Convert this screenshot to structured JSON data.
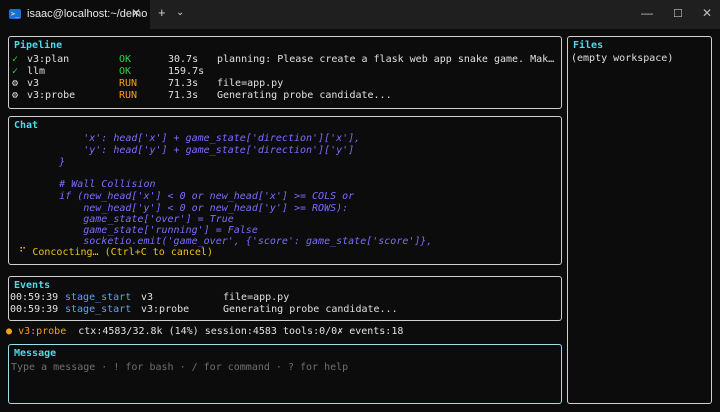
{
  "window": {
    "tab_title": "isaac@localhost:~/demo",
    "tab_icon": "terminal-icon",
    "close_glyph": "✕",
    "new_tab_glyph": "+",
    "dropdown_glyph": "⌄",
    "minimize_glyph": "—",
    "maximize_glyph": "☐",
    "closewin_glyph": "✕"
  },
  "pipeline": {
    "title": "Pipeline",
    "rows": [
      {
        "icon": "✓",
        "name": "v3:plan",
        "status": "OK",
        "time": "30.7s",
        "detail": "planning: Please create a flask web app snake game. Make no …"
      },
      {
        "icon": "✓",
        "name": "llm",
        "status": "OK",
        "time": "159.7s",
        "detail": ""
      },
      {
        "icon": "⚙",
        "name": "v3",
        "status": "RUN",
        "time": "71.3s",
        "detail": "file=app.py"
      },
      {
        "icon": "⚙",
        "name": "v3:probe",
        "status": "RUN",
        "time": "71.3s",
        "detail": "Generating probe candidate..."
      }
    ]
  },
  "chat": {
    "title": "Chat",
    "lines": [
      "            'x': head['x'] + game_state['direction']['x'],",
      "            'y': head['y'] + game_state['direction']['y']",
      "        }",
      "",
      "        # Wall Collision",
      "        if (new_head['x'] < 0 or new_head['x'] >= COLS or",
      "            new_head['y'] < 0 or new_head['y'] >= ROWS):",
      "            game_state['over'] = True",
      "            game_state['running'] = False",
      "            socketio.emit('game_over', {'score': game_state['score']},"
    ],
    "spinner": "⠋ Concocting…  (Ctrl+C to cancel)"
  },
  "events": {
    "title": "Events",
    "rows": [
      {
        "time": "00:59:39",
        "kind": "stage_start",
        "stage": "v3",
        "detail": "file=app.py"
      },
      {
        "time": "00:59:39",
        "kind": "stage_start",
        "stage": "v3:probe",
        "detail": "Generating probe candidate..."
      }
    ]
  },
  "status": {
    "dot": "●",
    "stage": "v3:probe",
    "text": "ctx:4583/32.8k (14%)  session:4583  tools:0/0✗  events:18"
  },
  "files": {
    "title": "Files",
    "empty": "(empty workspace)"
  },
  "message": {
    "title": "Message",
    "placeholder": "Type a message · ! for bash · / for command · ? for help"
  }
}
